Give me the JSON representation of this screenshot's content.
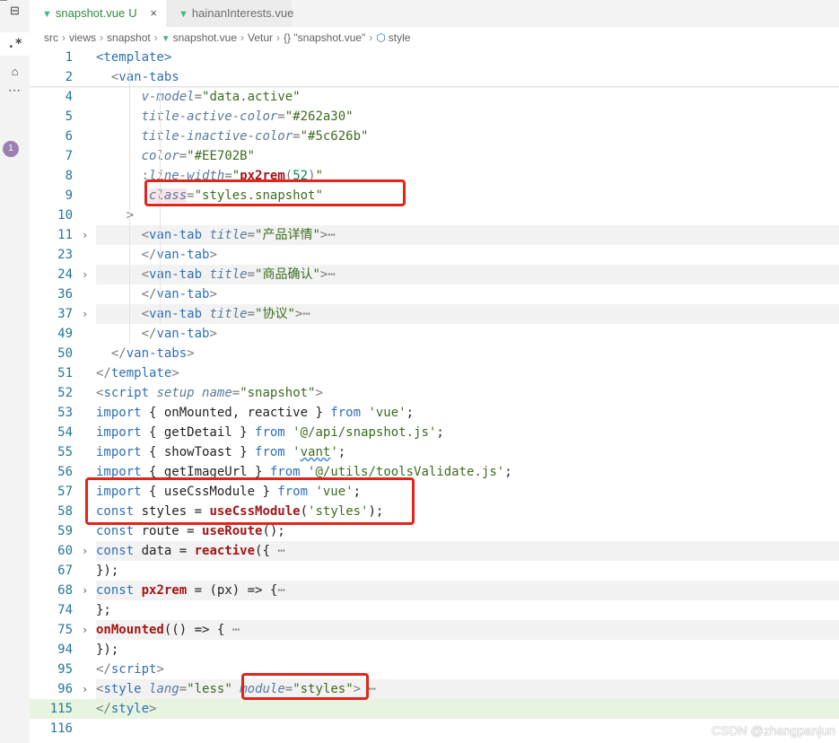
{
  "activity_bar": {
    "items": [
      "⊟",
      ".*",
      "⌂",
      "⋯"
    ],
    "badge": "1"
  },
  "tabs": [
    {
      "icon": "vue-icon",
      "label": "snapshot.vue",
      "status": "U",
      "close": "×"
    },
    {
      "icon": "vue-icon",
      "label": "hainanInterests.vue",
      "status": "",
      "close": ""
    }
  ],
  "breadcrumb": [
    "src",
    "views",
    "snapshot",
    "snapshot.vue",
    "Vetur",
    "{} \"snapshot.vue\"",
    "style"
  ],
  "code_lines": [
    {
      "n": "1",
      "fold": "",
      "segs": [
        [
          "tag",
          "<template>"
        ]
      ]
    },
    {
      "n": "2",
      "fold": "",
      "segs": [
        [
          "plain",
          "  "
        ],
        [
          "punct",
          "<"
        ],
        [
          "tag",
          "van-tabs"
        ]
      ]
    },
    {
      "n": "4",
      "fold": "",
      "segs": [
        [
          "plain",
          "      "
        ],
        [
          "attr",
          "v-model"
        ],
        [
          "punct",
          "="
        ],
        [
          "str",
          "\"data.active\""
        ]
      ]
    },
    {
      "n": "5",
      "fold": "",
      "segs": [
        [
          "plain",
          "      "
        ],
        [
          "attr",
          "title-active-color"
        ],
        [
          "punct",
          "="
        ],
        [
          "str",
          "\"#262a30\""
        ]
      ]
    },
    {
      "n": "6",
      "fold": "",
      "segs": [
        [
          "plain",
          "      "
        ],
        [
          "attr",
          "title-inactive-color"
        ],
        [
          "punct",
          "="
        ],
        [
          "str",
          "\"#5c626b\""
        ]
      ]
    },
    {
      "n": "7",
      "fold": "",
      "segs": [
        [
          "plain",
          "      "
        ],
        [
          "attr",
          "color"
        ],
        [
          "punct",
          "="
        ],
        [
          "str",
          "\"#EE702B\""
        ]
      ]
    },
    {
      "n": "8",
      "fold": "",
      "segs": [
        [
          "plain",
          "      "
        ],
        [
          "dir",
          ":"
        ],
        [
          "attr",
          "line-width"
        ],
        [
          "punct",
          "="
        ],
        [
          "str",
          "\""
        ],
        [
          "fn",
          "px2rem"
        ],
        [
          "punct",
          "("
        ],
        [
          "num",
          "52"
        ],
        [
          "punct",
          ")"
        ],
        [
          "str",
          "\""
        ]
      ]
    },
    {
      "n": "9",
      "fold": "",
      "segs": [
        [
          "plain",
          "      "
        ],
        [
          "dir",
          ":"
        ],
        [
          "attrhl",
          "class"
        ],
        [
          "punct",
          "="
        ],
        [
          "str",
          "\"styles.snapshot\""
        ]
      ]
    },
    {
      "n": "10",
      "fold": "",
      "segs": [
        [
          "plain",
          "    "
        ],
        [
          "punct",
          ">"
        ]
      ]
    },
    {
      "n": "11",
      "fold": "›",
      "bg": true,
      "segs": [
        [
          "plain",
          "      "
        ],
        [
          "punct",
          "<"
        ],
        [
          "tag",
          "van-tab "
        ],
        [
          "attr",
          "title"
        ],
        [
          "punct",
          "="
        ],
        [
          "str",
          "\"产品详情\""
        ],
        [
          "punct",
          ">"
        ],
        [
          "dots",
          "⋯"
        ]
      ]
    },
    {
      "n": "23",
      "fold": "",
      "segs": [
        [
          "plain",
          "      "
        ],
        [
          "punct",
          "</"
        ],
        [
          "tag",
          "van-tab"
        ],
        [
          "punct",
          ">"
        ]
      ]
    },
    {
      "n": "24",
      "fold": "›",
      "bg": true,
      "segs": [
        [
          "plain",
          "      "
        ],
        [
          "punct",
          "<"
        ],
        [
          "tag",
          "van-tab "
        ],
        [
          "attr",
          "title"
        ],
        [
          "punct",
          "="
        ],
        [
          "str",
          "\"商品确认\""
        ],
        [
          "punct",
          ">"
        ],
        [
          "dots",
          "⋯"
        ]
      ]
    },
    {
      "n": "36",
      "fold": "",
      "segs": [
        [
          "plain",
          "      "
        ],
        [
          "punct",
          "</"
        ],
        [
          "tag",
          "van-tab"
        ],
        [
          "punct",
          ">"
        ]
      ]
    },
    {
      "n": "37",
      "fold": "›",
      "bg": true,
      "segs": [
        [
          "plain",
          "      "
        ],
        [
          "punct",
          "<"
        ],
        [
          "tag",
          "van-tab "
        ],
        [
          "attr",
          "title"
        ],
        [
          "punct",
          "="
        ],
        [
          "str",
          "\"协议\""
        ],
        [
          "punct",
          ">"
        ],
        [
          "dots",
          "⋯"
        ]
      ]
    },
    {
      "n": "49",
      "fold": "",
      "segs": [
        [
          "plain",
          "      "
        ],
        [
          "punct",
          "</"
        ],
        [
          "tag",
          "van-tab"
        ],
        [
          "punct",
          ">"
        ]
      ]
    },
    {
      "n": "50",
      "fold": "",
      "segs": [
        [
          "plain",
          "  "
        ],
        [
          "punct",
          "</"
        ],
        [
          "tag",
          "van-tabs"
        ],
        [
          "punct",
          ">"
        ]
      ]
    },
    {
      "n": "51",
      "fold": "",
      "segs": [
        [
          "punct",
          "</"
        ],
        [
          "tag",
          "template"
        ],
        [
          "punct",
          ">"
        ]
      ]
    },
    {
      "n": "52",
      "fold": "",
      "segs": [
        [
          "punct",
          "<"
        ],
        [
          "tag",
          "script "
        ],
        [
          "attr",
          "setup"
        ],
        [
          "plain",
          " "
        ],
        [
          "attr",
          "name"
        ],
        [
          "punct",
          "="
        ],
        [
          "str",
          "\"snapshot\""
        ],
        [
          "punct",
          ">"
        ]
      ]
    },
    {
      "n": "53",
      "fold": "",
      "segs": [
        [
          "kw",
          "import"
        ],
        [
          "plain",
          " { onMounted, reactive } "
        ],
        [
          "kw",
          "from"
        ],
        [
          "plain",
          " "
        ],
        [
          "str",
          "'vue'"
        ],
        [
          "plain",
          ";"
        ]
      ]
    },
    {
      "n": "54",
      "fold": "",
      "segs": [
        [
          "kw",
          "import"
        ],
        [
          "plain",
          " { getDetail } "
        ],
        [
          "kw",
          "from"
        ],
        [
          "plain",
          " "
        ],
        [
          "str",
          "'@/api/snapshot.js'"
        ],
        [
          "plain",
          ";"
        ]
      ]
    },
    {
      "n": "55",
      "fold": "",
      "segs": [
        [
          "kw",
          "import"
        ],
        [
          "plain",
          " { showToast } "
        ],
        [
          "kw",
          "from"
        ],
        [
          "plain",
          " "
        ],
        [
          "str",
          "'"
        ],
        [
          "strsq",
          "vant"
        ],
        [
          "str",
          "'"
        ],
        [
          "plain",
          ";"
        ]
      ]
    },
    {
      "n": "56",
      "fold": "",
      "segs": [
        [
          "kw",
          "import"
        ],
        [
          "plain",
          " { getImageUrl } "
        ],
        [
          "kw",
          "from"
        ],
        [
          "plain",
          " "
        ],
        [
          "str",
          "'@/utils/toolsValidate.js'"
        ],
        [
          "plain",
          ";"
        ]
      ]
    },
    {
      "n": "57",
      "fold": "",
      "segs": [
        [
          "kw",
          "import"
        ],
        [
          "plain",
          " { useCssModule } "
        ],
        [
          "kw",
          "from"
        ],
        [
          "plain",
          " "
        ],
        [
          "str",
          "'vue'"
        ],
        [
          "plain",
          ";"
        ]
      ]
    },
    {
      "n": "58",
      "fold": "",
      "segs": [
        [
          "kw",
          "const"
        ],
        [
          "plain",
          " styles = "
        ],
        [
          "fn",
          "useCssModule"
        ],
        [
          "plain",
          "("
        ],
        [
          "str",
          "'styles'"
        ],
        [
          "plain",
          ");"
        ]
      ]
    },
    {
      "n": "59",
      "fold": "",
      "segs": [
        [
          "kw",
          "const"
        ],
        [
          "plain",
          " route = "
        ],
        [
          "fn",
          "useRoute"
        ],
        [
          "plain",
          "();"
        ]
      ]
    },
    {
      "n": "60",
      "fold": "›",
      "bg": true,
      "segs": [
        [
          "kw",
          "const"
        ],
        [
          "plain",
          " data = "
        ],
        [
          "fn",
          "reactive"
        ],
        [
          "plain",
          "({"
        ],
        [
          "dots",
          " ⋯"
        ]
      ]
    },
    {
      "n": "67",
      "fold": "",
      "segs": [
        [
          "plain",
          "});"
        ]
      ]
    },
    {
      "n": "68",
      "fold": "›",
      "bg": true,
      "segs": [
        [
          "kw",
          "const"
        ],
        [
          "plain",
          " "
        ],
        [
          "fn",
          "px2rem"
        ],
        [
          "plain",
          " = (px) => {"
        ],
        [
          "dots",
          "⋯"
        ]
      ]
    },
    {
      "n": "74",
      "fold": "",
      "segs": [
        [
          "plain",
          "};"
        ]
      ]
    },
    {
      "n": "75",
      "fold": "›",
      "bg": true,
      "segs": [
        [
          "fn",
          "onMounted"
        ],
        [
          "plain",
          "(() => {"
        ],
        [
          "dots",
          " ⋯"
        ]
      ]
    },
    {
      "n": "94",
      "fold": "",
      "segs": [
        [
          "plain",
          "});"
        ]
      ]
    },
    {
      "n": "95",
      "fold": "",
      "segs": [
        [
          "punct",
          "</"
        ],
        [
          "tag",
          "script"
        ],
        [
          "punct",
          ">"
        ]
      ]
    },
    {
      "n": "96",
      "fold": "›",
      "bg": true,
      "segs": [
        [
          "punct",
          "<"
        ],
        [
          "tag",
          "style "
        ],
        [
          "attr",
          "lang"
        ],
        [
          "punct",
          "="
        ],
        [
          "str",
          "\"less\""
        ],
        [
          "plain",
          " "
        ],
        [
          "attr",
          "module"
        ],
        [
          "punct",
          "="
        ],
        [
          "str",
          "\"styles\""
        ],
        [
          "punct",
          ">"
        ],
        [
          "dots",
          " ⋯"
        ]
      ]
    },
    {
      "n": "115",
      "fold": "",
      "hl": true,
      "segs": [
        [
          "punct",
          "</"
        ],
        [
          "tag",
          "style"
        ],
        [
          "punct",
          ">"
        ]
      ]
    },
    {
      "n": "116",
      "fold": "",
      "segs": []
    }
  ],
  "watermark": "CSDN @zhangpanjun"
}
